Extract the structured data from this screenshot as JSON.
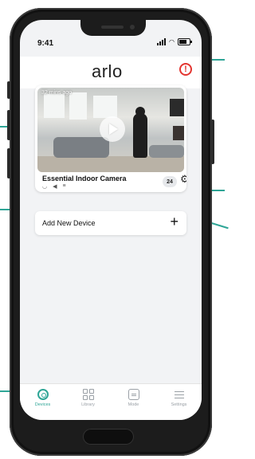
{
  "status_bar": {
    "time": "9:41"
  },
  "header": {
    "logo": "arlo",
    "alert_icon": "alert-icon"
  },
  "camera_card": {
    "time_ago": "32 mins ago",
    "name": "Essential Indoor Camera",
    "badge_count": "24",
    "status_icons": [
      "wifi-icon",
      "speaker-icon",
      "battery-icon"
    ]
  },
  "add_device": {
    "label": "Add New Device",
    "plus": "+"
  },
  "tabbar": {
    "tabs": [
      {
        "label": "Devices",
        "icon": "devices-icon",
        "active": true
      },
      {
        "label": "Library",
        "icon": "library-icon",
        "active": false
      },
      {
        "label": "Mode",
        "icon": "mode-icon",
        "active": false
      },
      {
        "label": "Settings",
        "icon": "settings-icon",
        "active": false
      }
    ]
  },
  "colors": {
    "accent": "#2ea596",
    "alert": "#e3342f"
  }
}
